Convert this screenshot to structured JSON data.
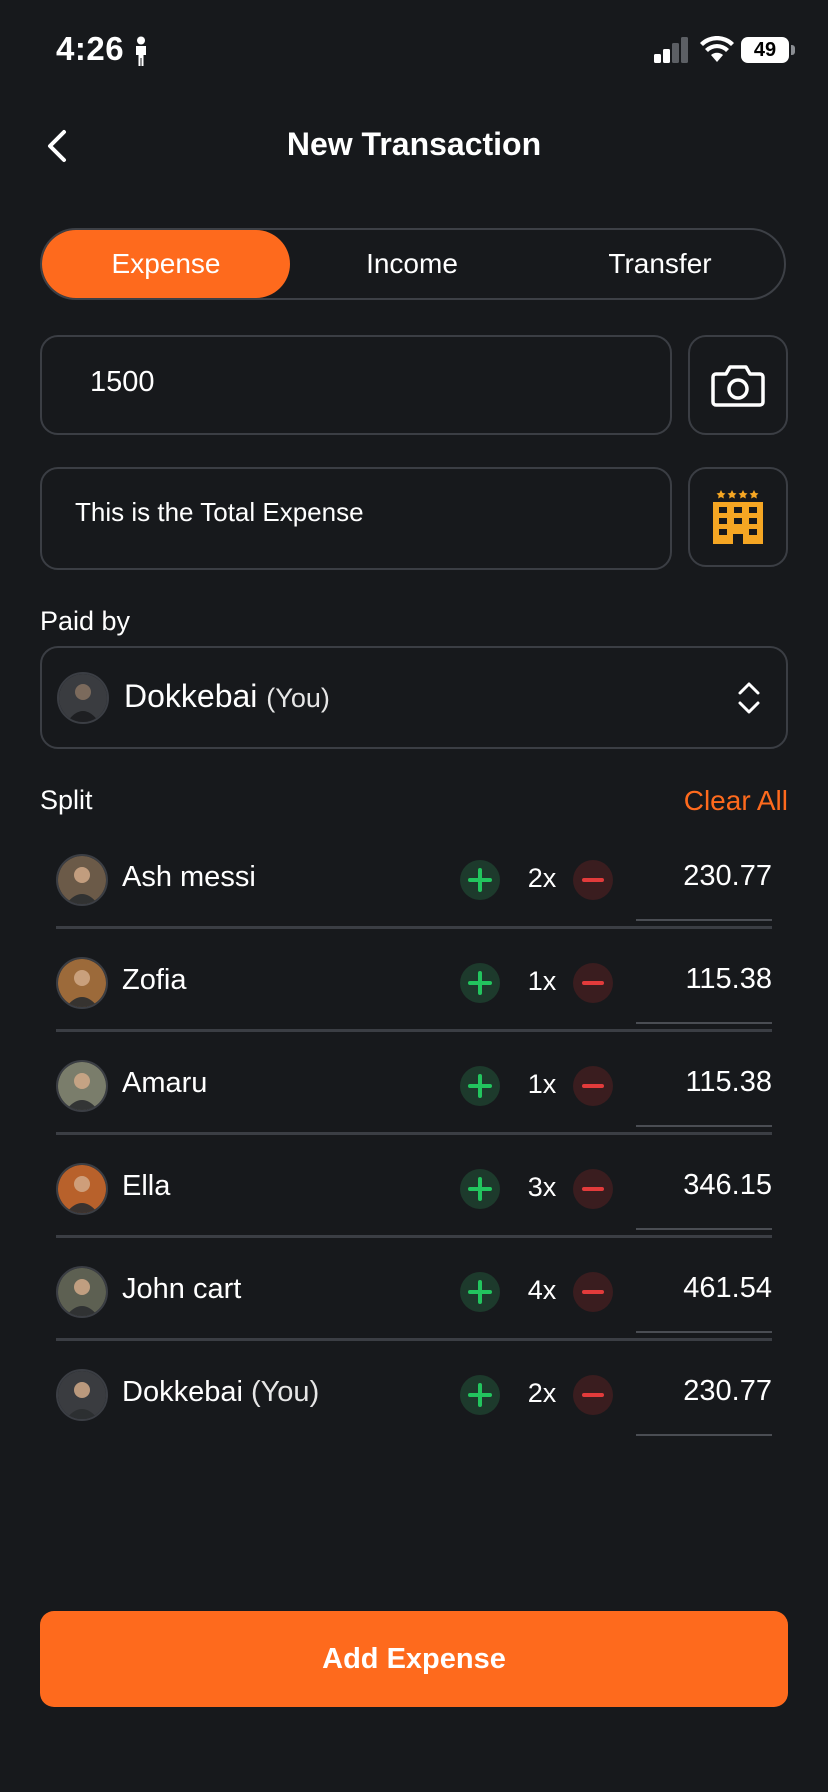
{
  "status_bar": {
    "time": "4:26",
    "battery": "49"
  },
  "header": {
    "title": "New Transaction"
  },
  "tabs": [
    {
      "label": "Expense",
      "active": true
    },
    {
      "label": "Income",
      "active": false
    },
    {
      "label": "Transfer",
      "active": false
    }
  ],
  "amount": {
    "value": "1500"
  },
  "note": {
    "value": "This is the Total Expense"
  },
  "paid_by": {
    "label": "Paid by",
    "name": "Dokkebai",
    "suffix": "(You)"
  },
  "split": {
    "label": "Split",
    "clear_all": "Clear All",
    "rows": [
      {
        "name": "Ash messi",
        "you": "",
        "multiplier": "2x",
        "amount": "230.77",
        "avatar_color": "#6b5a48"
      },
      {
        "name": "Zofia",
        "you": "",
        "multiplier": "1x",
        "amount": "115.38",
        "avatar_color": "#9c6a3a"
      },
      {
        "name": "Amaru",
        "you": "",
        "multiplier": "1x",
        "amount": "115.38",
        "avatar_color": "#7a7d6b"
      },
      {
        "name": "Ella",
        "you": "",
        "multiplier": "3x",
        "amount": "346.15",
        "avatar_color": "#b8612b"
      },
      {
        "name": "John cart",
        "you": "",
        "multiplier": "4x",
        "amount": "461.54",
        "avatar_color": "#5d6052"
      },
      {
        "name": "Dokkebai",
        "you": "(You)",
        "multiplier": "2x",
        "amount": "230.77",
        "avatar_color": "#3a3c40"
      }
    ]
  },
  "submit": {
    "label": "Add Expense"
  },
  "colors": {
    "accent": "#fe6a1d",
    "background": "#17191c",
    "plus": "#22c55e",
    "minus": "#e23b3b",
    "category_icon": "#f5a623"
  },
  "icons": [
    "back-chevron-icon",
    "camera-icon",
    "hotel-icon",
    "up-down-chevron-icon",
    "plus-icon",
    "minus-icon"
  ]
}
